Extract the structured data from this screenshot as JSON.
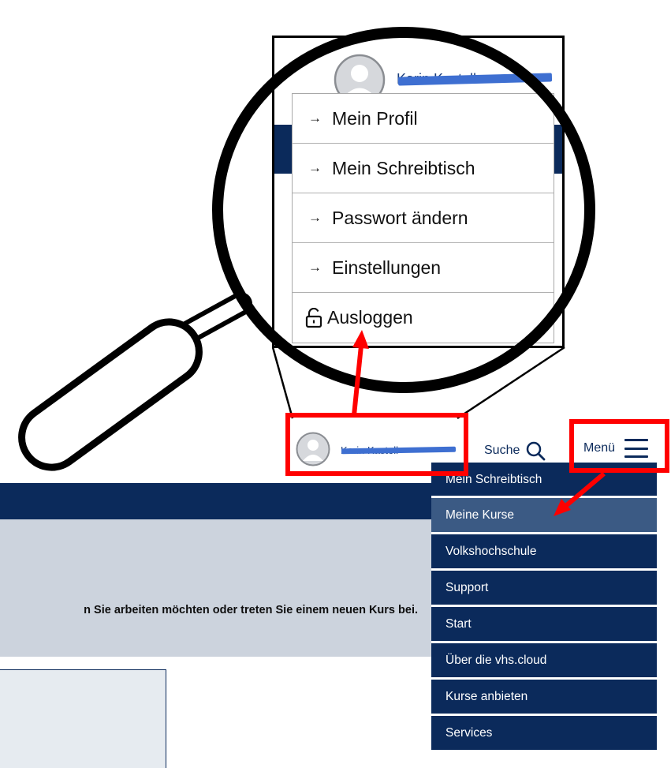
{
  "header": {
    "username": "Karin Kastell",
    "search_label": "Suche",
    "menu_label": "Menü"
  },
  "hero": {
    "instruction_text": "n Sie arbeiten möchten oder treten Sie einem neuen Kurs bei."
  },
  "nav_menu": {
    "items": [
      {
        "label": "Mein Schreibtisch"
      },
      {
        "label": "Meine Kurse"
      },
      {
        "label": "Volkshochschule"
      },
      {
        "label": "Support"
      },
      {
        "label": "Start"
      },
      {
        "label": "Über die vhs.cloud"
      },
      {
        "label": "Kurse anbieten"
      },
      {
        "label": "Services"
      }
    ],
    "active_index": 1
  },
  "magnifier": {
    "username": "Karin Kastell",
    "user_menu": [
      {
        "label": "Mein Profil",
        "icon": "arrow-right-icon"
      },
      {
        "label": "Mein Schreibtisch",
        "icon": "arrow-right-icon"
      },
      {
        "label": "Passwort ändern",
        "icon": "arrow-right-icon"
      },
      {
        "label": "Einstellungen",
        "icon": "arrow-right-icon"
      },
      {
        "label": "Ausloggen",
        "icon": "unlock-icon"
      }
    ]
  },
  "colors": {
    "navy": "#0b2a5b",
    "active_item": "#3b5a84",
    "hero_grey": "#ccd3dd",
    "highlight_red": "#ff0000",
    "redaction_blue": "#3e6fd1"
  }
}
